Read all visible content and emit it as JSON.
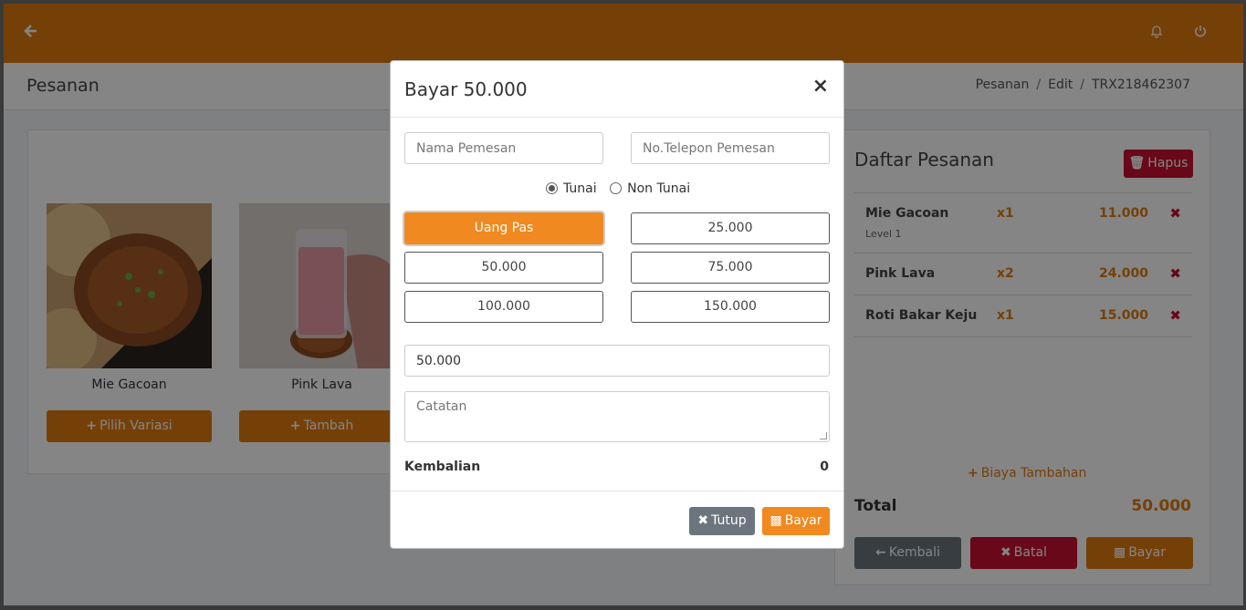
{
  "app": {
    "page_title": "Pesanan",
    "breadcrumb": [
      "Pesanan",
      "Edit",
      "TRX218462307"
    ]
  },
  "products": [
    {
      "name": "Mie Gacoan",
      "button": "Pilih Variasi"
    },
    {
      "name": "Pink Lava",
      "button": "Tambah"
    }
  ],
  "orders": {
    "title": "Daftar Pesanan",
    "hapus_label": "Hapus",
    "items": [
      {
        "name": "Mie Gacoan",
        "variant": "Level 1",
        "qty": "x1",
        "price": "11.000"
      },
      {
        "name": "Pink Lava",
        "variant": "",
        "qty": "x2",
        "price": "24.000"
      },
      {
        "name": "Roti Bakar Keju",
        "variant": "",
        "qty": "x1",
        "price": "15.000"
      }
    ],
    "biaya_tambahan": "Biaya Tambahan",
    "total_label": "Total",
    "total_value": "50.000",
    "btn_kembali": "Kembali",
    "btn_batal": "Batal",
    "btn_bayar": "Bayar"
  },
  "modal": {
    "title": "Bayar 50.000",
    "nama_placeholder": "Nama Pemesan",
    "telepon_placeholder": "No.Telepon Pemesan",
    "radio_tunai": "Tunai",
    "radio_non_tunai": "Non Tunai",
    "amounts": [
      "Uang Pas",
      "25.000",
      "50.000",
      "75.000",
      "100.000",
      "150.000"
    ],
    "amount_value": "50.000",
    "catatan_placeholder": "Catatan",
    "kembalian_label": "Kembalian",
    "kembalian_value": "0",
    "btn_tutup": "Tutup",
    "btn_bayar": "Bayar"
  },
  "colors": {
    "brand": "#e07b10",
    "danger": "#c8102e",
    "secondary": "#6c757d"
  }
}
